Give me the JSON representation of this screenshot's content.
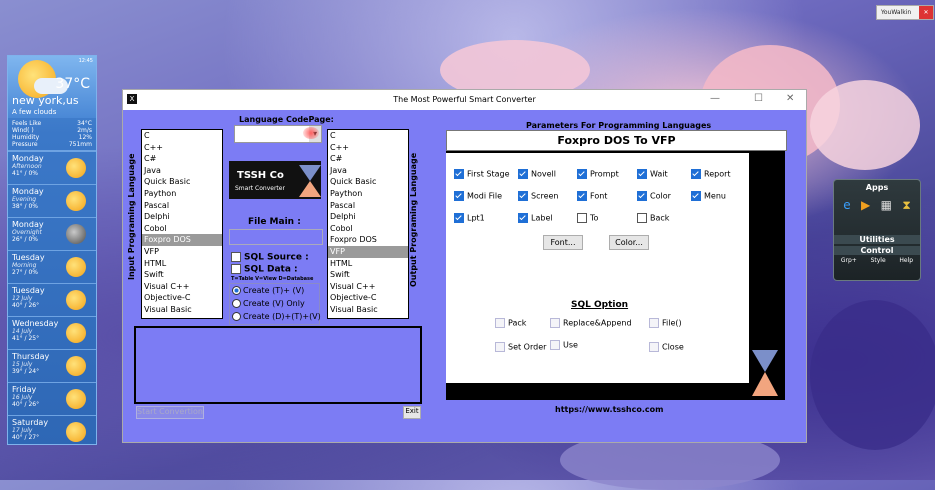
{
  "taskbar_badge": "YouWalkin",
  "weather": {
    "temp": "37°C",
    "city": "new york,us",
    "condition": "A few clouds",
    "small": "12:45",
    "stats": [
      {
        "label": "Feels Like",
        "value": "34°C"
      },
      {
        "label": "Wind( )",
        "value": "2m/s"
      },
      {
        "label": "Humidity",
        "value": "12%"
      },
      {
        "label": "Pressure",
        "value": "751mm"
      }
    ],
    "days": [
      {
        "day": "Monday",
        "part": "Afternoon",
        "range": "41° / 0%",
        "icon": "sun-icon"
      },
      {
        "day": "Monday",
        "part": "Evening",
        "range": "38° / 0%",
        "icon": "sun-icon"
      },
      {
        "day": "Monday",
        "part": "Overnight",
        "range": "26° / 0%",
        "icon": "moon-icon"
      },
      {
        "day": "Tuesday",
        "part": "Morning",
        "range": "27° / 0%",
        "icon": "sun-icon"
      },
      {
        "day": "Tuesday",
        "part": "12 July",
        "range": "40° / 26°",
        "icon": "sun-icon"
      },
      {
        "day": "Wednesday",
        "part": "14 July",
        "range": "41° / 25°",
        "icon": "sun-icon"
      },
      {
        "day": "Thursday",
        "part": "15 July",
        "range": "39° / 24°",
        "icon": "sun-icon"
      },
      {
        "day": "Friday",
        "part": "16 July",
        "range": "40° / 26°",
        "icon": "sun-icon"
      },
      {
        "day": "Saturday",
        "part": "17 July",
        "range": "40° / 27°",
        "icon": "sun-icon"
      }
    ]
  },
  "apps_gadget": {
    "title": "Apps",
    "utilities": "Utilities",
    "control": "Control",
    "sub": [
      "Grp+",
      "Style",
      "Help"
    ]
  },
  "window": {
    "title": "The Most Powerful Smart Converter",
    "min": "—",
    "max": "☐",
    "close": "✕"
  },
  "left": {
    "input_label": "Input Programing Language",
    "output_label": "Output Programing Language",
    "codepage_label": "Language CodePage:",
    "logo_title": "TSSH Co",
    "logo_sub": "Smart Converter",
    "file_main": "File Main :",
    "sql_source": "SQL Source :",
    "sql_data": "SQL Data :",
    "sql_hint": "T=Table  V=View  D=Database",
    "radios": [
      "Create (T)+ (V)",
      "Create (V) Only",
      "Create (D)+(T)+(V)"
    ],
    "start_btn": "Start Convertion",
    "exit_btn": "Exit"
  },
  "input_langs": [
    "C",
    "C++",
    "C#",
    "Java",
    "Quick Basic",
    "Paython",
    "Pascal",
    "Delphi",
    "Cobol",
    "Foxpro DOS",
    "VFP",
    "HTML",
    "Swift",
    "Visual C++",
    "Objective-C",
    "Visual Basic"
  ],
  "output_langs": [
    "C",
    "C++",
    "C#",
    "Java",
    "Quick Basic",
    "Paython",
    "Pascal",
    "Delphi",
    "Cobol",
    "Foxpro DOS",
    "VFP",
    "HTML",
    "Swift",
    "Visual C++",
    "Objective-C",
    "Visual Basic"
  ],
  "params": {
    "header": "Parameters For Programming Languages",
    "subtitle": "Foxpro DOS To VFP",
    "checks": [
      {
        "label": "First Stage",
        "on": true
      },
      {
        "label": "Novell",
        "on": true
      },
      {
        "label": "Prompt",
        "on": true
      },
      {
        "label": "Wait",
        "on": true
      },
      {
        "label": "Report",
        "on": true
      },
      {
        "label": "Modi File",
        "on": true
      },
      {
        "label": "Screen",
        "on": true
      },
      {
        "label": "Font",
        "on": true
      },
      {
        "label": "Color",
        "on": true
      },
      {
        "label": "Menu",
        "on": true
      },
      {
        "label": "Lpt1",
        "on": true
      },
      {
        "label": "Label",
        "on": true
      },
      {
        "label": "To",
        "on": false
      },
      {
        "label": "Back",
        "on": false
      }
    ],
    "font_btn": "Font...",
    "color_btn": "Color...",
    "sql_option": "SQL Option",
    "sql_checks": [
      "Pack",
      "Replace&Append",
      "File()",
      "Set Order",
      "Use",
      "Close"
    ],
    "url": "https://www.tsshco.com"
  }
}
